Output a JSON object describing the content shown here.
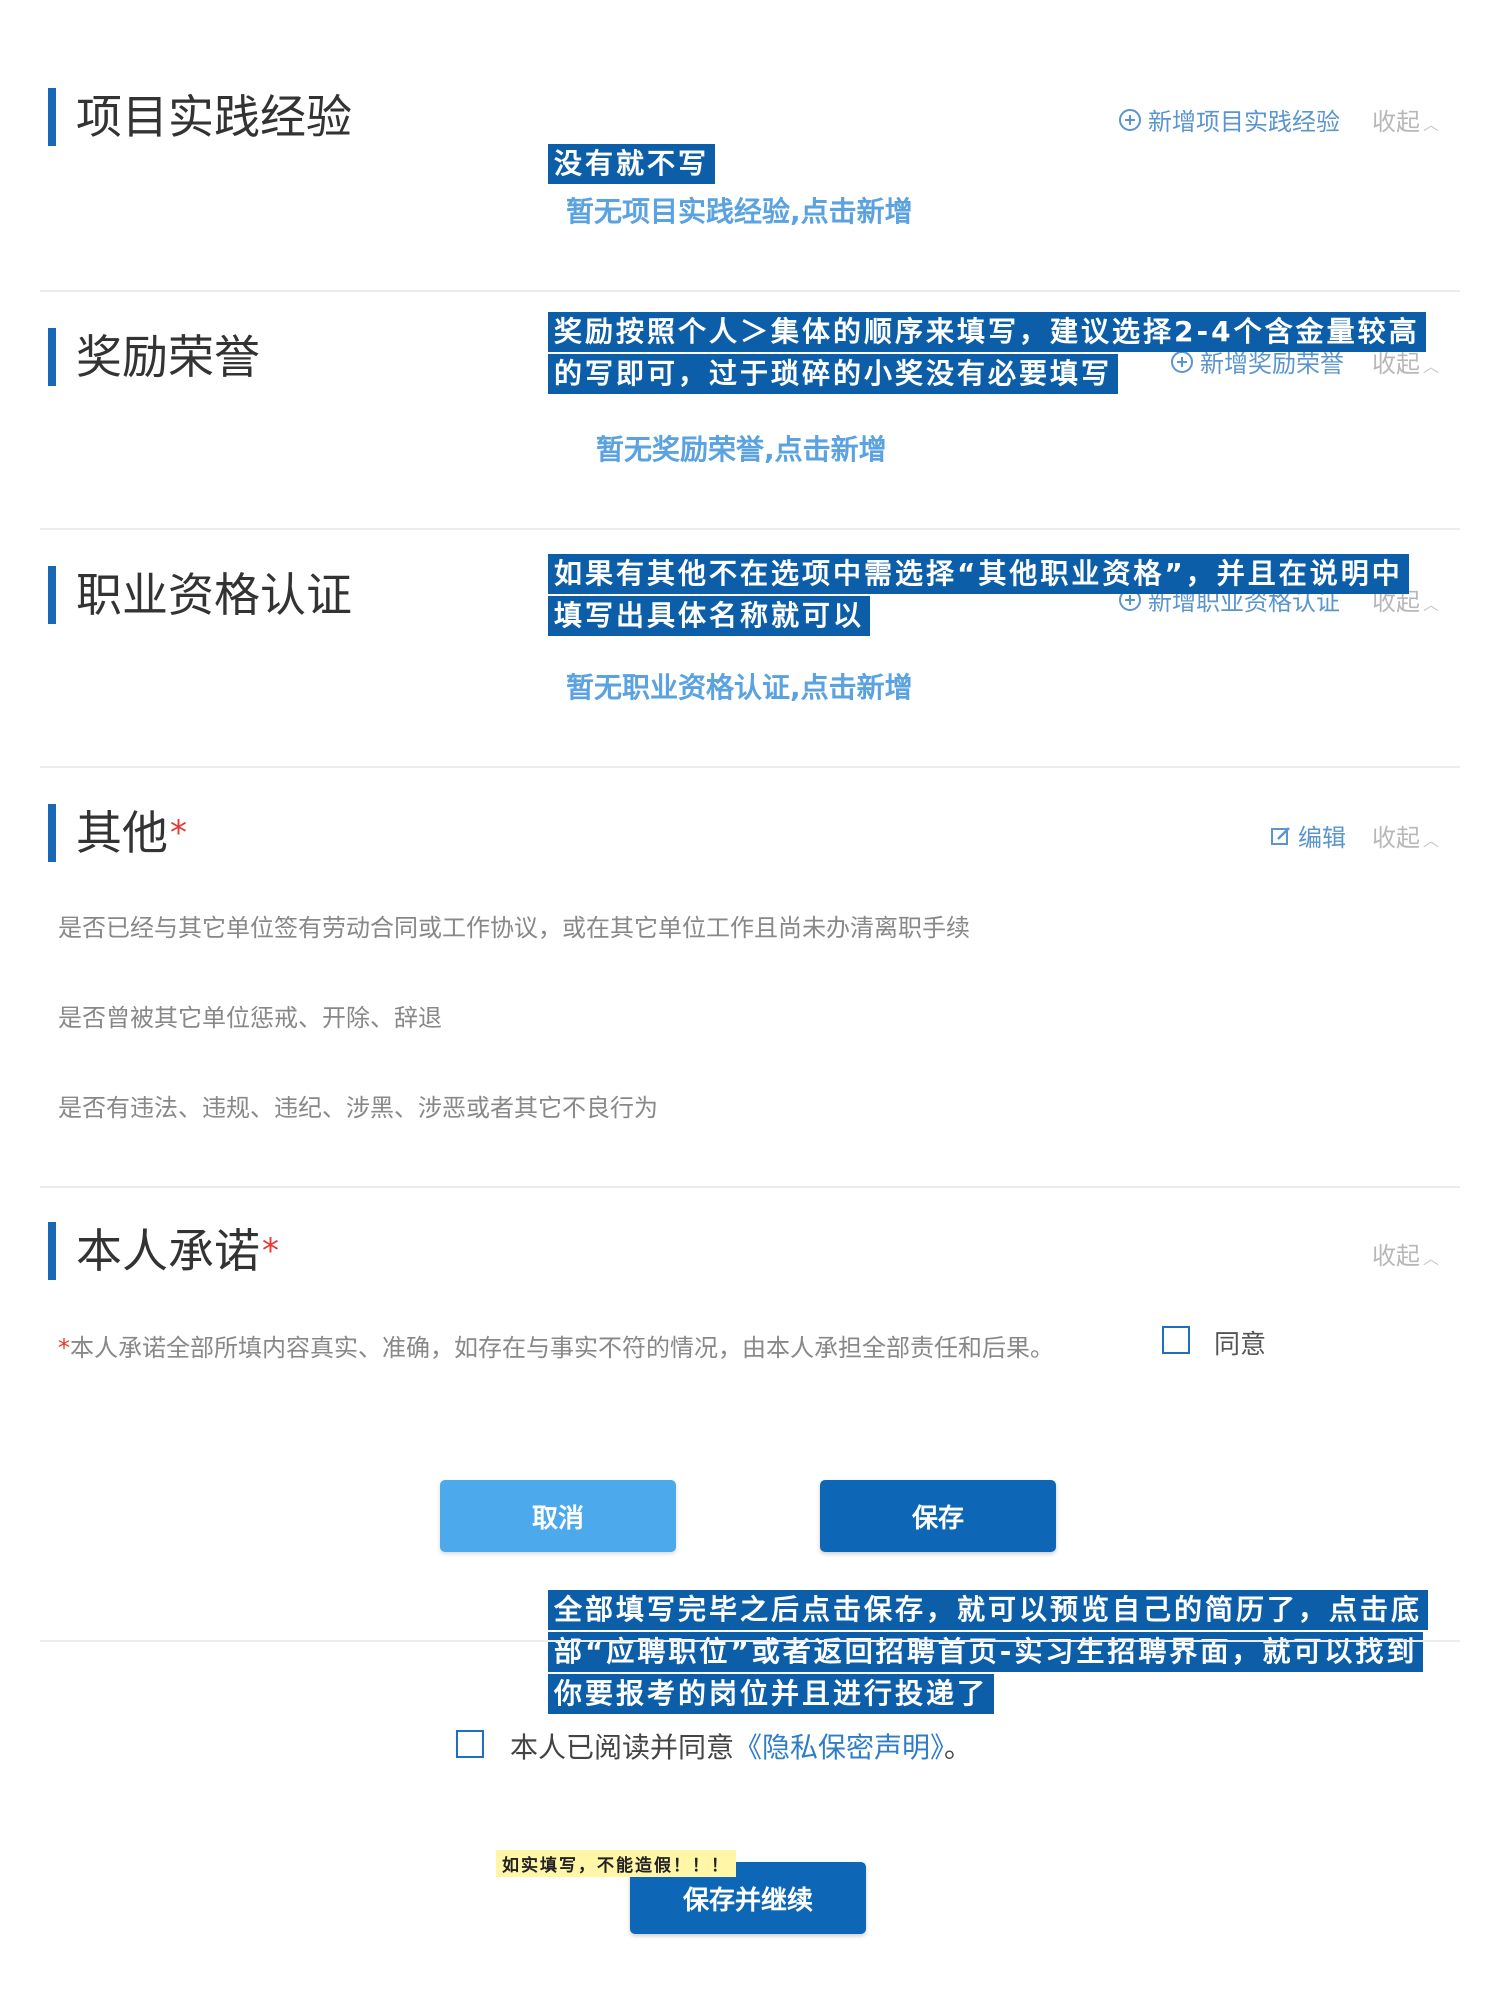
{
  "sections": {
    "projects": {
      "title": "项目实践经验",
      "add_label": "新增项目实践经验",
      "collapse_label": "收起",
      "empty_text": "暂无项目实践经验,点击新增"
    },
    "awards": {
      "title": "奖励荣誉",
      "add_label": "新增奖励荣誉",
      "collapse_label": "收起",
      "empty_text": "暂无奖励荣誉,点击新增"
    },
    "certifications": {
      "title": "职业资格认证",
      "add_label": "新增职业资格认证",
      "collapse_label": "收起",
      "empty_text": "暂无职业资格认证,点击新增"
    },
    "other": {
      "title": "其他",
      "required_mark": "*",
      "edit_label": "编辑",
      "collapse_label": "收起",
      "questions": [
        "是否已经与其它单位签有劳动合同或工作协议，或在其它单位工作且尚未办清离职手续",
        "是否曾被其它单位惩戒、开除、辞退",
        "是否有违法、违规、违纪、涉黑、涉恶或者其它不良行为"
      ]
    },
    "commitment": {
      "title": "本人承诺",
      "required_mark": "*",
      "collapse_label": "收起",
      "text_star": "*",
      "text": "本人承诺全部所填内容真实、准确，如存在与事实不符的情况，由本人承担全部责任和后果。",
      "agree_label": "同意"
    }
  },
  "buttons": {
    "cancel": "取消",
    "save": "保存",
    "save_continue": "保存并继续"
  },
  "privacy": {
    "prefix": "本人已阅读并同意",
    "link": "《隐私保密声明》",
    "suffix": "。"
  },
  "annotations": {
    "projects_note": "没有就不写",
    "awards_note_line1": "奖励按照个人＞集体的顺序来填写，建议选择2-4个含金量较高",
    "awards_note_line2": "的写即可，过于琐碎的小奖没有必要填写",
    "cert_note_line1": "如果有其他不在选项中需选择“其他职业资格”，并且在说明中",
    "cert_note_line2": "填写出具体名称就可以",
    "save_note_line1": "全部填写完毕之后点击保存，就可以预览自己的简历了，点击底",
    "save_note_line2": "部“应聘职位”或者返回招聘首页-实习生招聘界面，就可以找到",
    "save_note_line3": "你要报考的岗位并且进行投递了",
    "honesty_note": "如实填写，不能造假！！！"
  },
  "icons": {
    "add": "plus-circle-icon",
    "edit": "edit-icon",
    "collapse": "chevron-up-icon"
  },
  "colors": {
    "accent": "#1769b8",
    "note_bg": "#0d5ea9",
    "link": "#5aa2e0",
    "required": "#e53935"
  }
}
